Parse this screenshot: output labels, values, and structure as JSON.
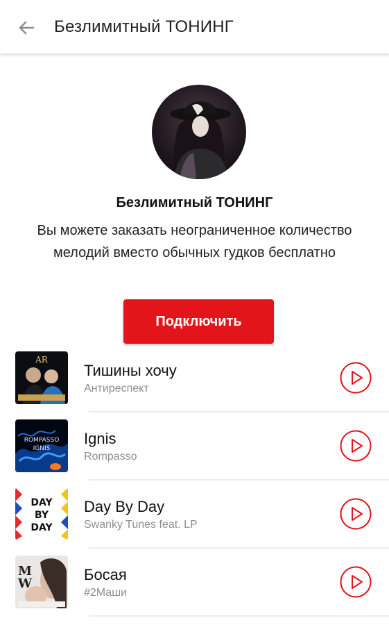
{
  "header": {
    "title": "Безлимитный ТОНИНГ",
    "back_icon": "arrow-left-icon"
  },
  "promo": {
    "title": "Безлимитный ТОНИНГ",
    "description": "Вы можете заказать неограниченное количество мелодий вместо обычных гудков бесплатно",
    "button_label": "Подключить",
    "accent_color": "#e4151a"
  },
  "tracks": [
    {
      "title": "Тишины хочу",
      "artist": "Антиреспект",
      "play_icon": "play-circle-icon"
    },
    {
      "title": "Ignis",
      "artist": "Rompasso",
      "play_icon": "play-circle-icon"
    },
    {
      "title": "Day By Day",
      "artist": "Swanky Tunes feat. LP",
      "play_icon": "play-circle-icon"
    },
    {
      "title": "Босая",
      "artist": "#2Маши",
      "play_icon": "play-circle-icon"
    }
  ]
}
